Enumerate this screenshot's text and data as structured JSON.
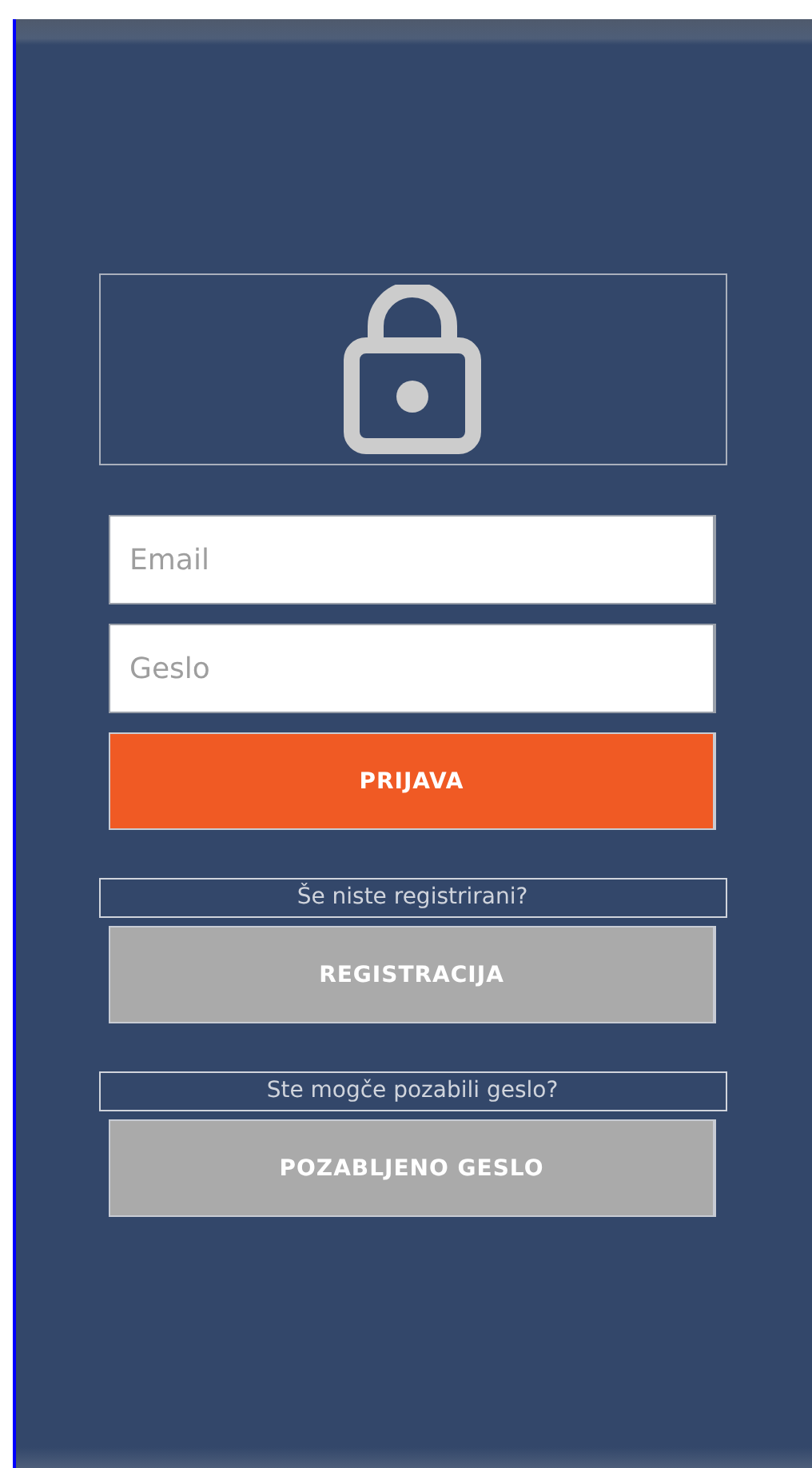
{
  "login": {
    "email": {
      "placeholder": "Email"
    },
    "password": {
      "placeholder": "Geslo"
    },
    "submit": "PRIJAVA"
  },
  "register": {
    "prompt": "Še niste registrirani?",
    "button": "REGISTRACIJA"
  },
  "forgot": {
    "prompt": "Ste mogče pozabili geslo?",
    "button": "POZABLJENO GESLO"
  }
}
